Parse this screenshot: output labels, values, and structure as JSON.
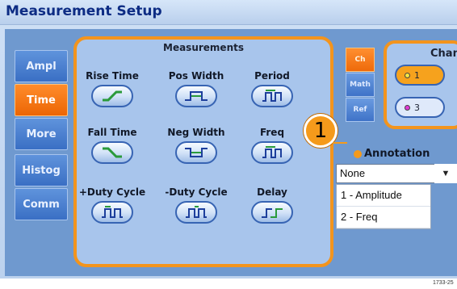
{
  "window": {
    "title": "Measurement Setup"
  },
  "sidebar": {
    "tabs": [
      {
        "label": "Ampl",
        "active": false
      },
      {
        "label": "Time",
        "active": true
      },
      {
        "label": "More",
        "active": false
      },
      {
        "label": "Histog",
        "active": false
      },
      {
        "label": "Comm",
        "active": false
      }
    ]
  },
  "measurements": {
    "title": "Measurements",
    "items": [
      {
        "label": "Rise Time",
        "icon": "rise-time-icon"
      },
      {
        "label": "Pos Width",
        "icon": "pos-width-icon"
      },
      {
        "label": "Period",
        "icon": "period-icon"
      },
      {
        "label": "Fall Time",
        "icon": "fall-time-icon"
      },
      {
        "label": "Neg Width",
        "icon": "neg-width-icon"
      },
      {
        "label": "Freq",
        "icon": "freq-icon"
      },
      {
        "label": "+Duty Cycle",
        "icon": "pos-duty-cycle-icon"
      },
      {
        "label": "-Duty Cycle",
        "icon": "neg-duty-cycle-icon"
      },
      {
        "label": "Delay",
        "icon": "delay-icon"
      }
    ]
  },
  "source_tabs": [
    {
      "label": "Ch",
      "active": true
    },
    {
      "label": "Math",
      "active": false
    },
    {
      "label": "Ref",
      "active": false
    }
  ],
  "channels": {
    "title": "Chan",
    "buttons": [
      {
        "label": "1",
        "dot_color": "#f5e642",
        "fill": "#f6a21d"
      },
      {
        "label": "3",
        "dot_color": "#e03bd6",
        "fill": "#dfe9fa"
      }
    ]
  },
  "callout": {
    "label": "1"
  },
  "annotation": {
    "label": "Annotation",
    "selected": "None",
    "options": [
      "1 - Amplitude",
      "2 - Freq"
    ]
  },
  "figure_id": "1733-25",
  "colors": {
    "accent_orange": "#f3941d",
    "tab_blue": "#3a6fc4",
    "panel_blue": "#6f99cf",
    "title_navy": "#0d2c84"
  }
}
